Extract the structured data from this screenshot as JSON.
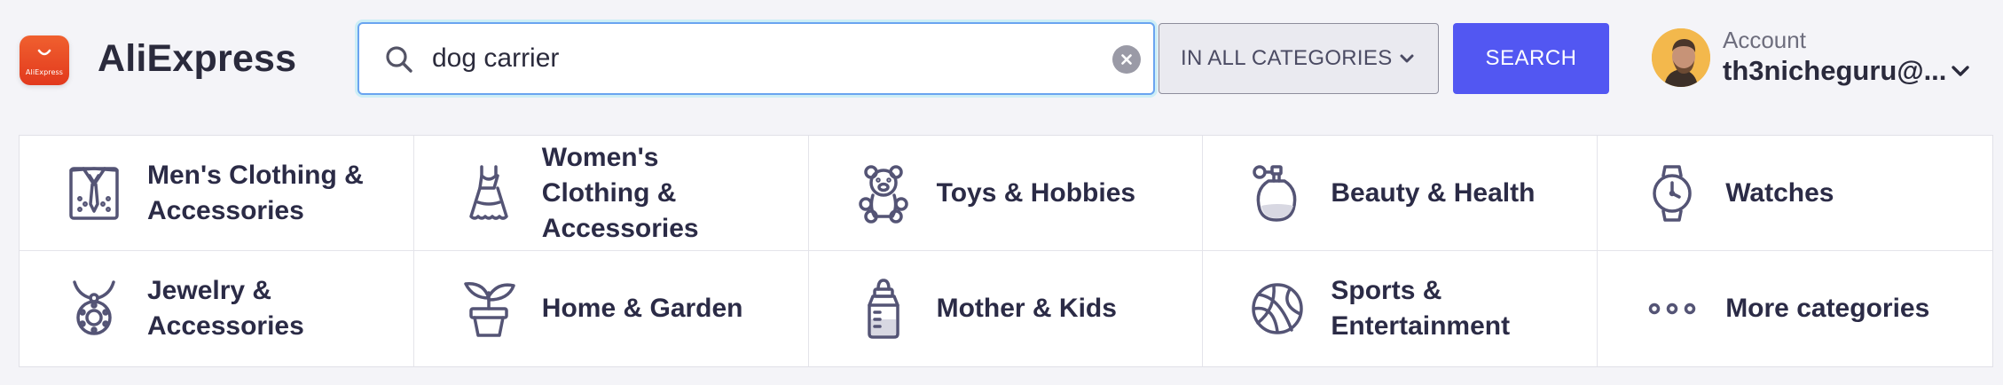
{
  "header": {
    "logo_text": "AliExpress",
    "brand": "AliExpress",
    "search": {
      "value": "dog carrier",
      "placeholder": ""
    },
    "category_select": "IN ALL CATEGORIES",
    "search_button": "SEARCH",
    "account": {
      "label": "Account",
      "email": "th3nicheguru@..."
    }
  },
  "categories": [
    {
      "label": "Men's Clothing & Accessories",
      "icon": "shirt-tie-icon"
    },
    {
      "label": "Women's Clothing & Accessories",
      "icon": "dress-icon"
    },
    {
      "label": "Toys & Hobbies",
      "icon": "teddy-bear-icon"
    },
    {
      "label": "Beauty & Health",
      "icon": "perfume-icon"
    },
    {
      "label": "Watches",
      "icon": "watch-icon"
    },
    {
      "label": "Jewelry & Accessories",
      "icon": "necklace-icon"
    },
    {
      "label": "Home & Garden",
      "icon": "plant-pot-icon"
    },
    {
      "label": "Mother & Kids",
      "icon": "baby-bottle-icon"
    },
    {
      "label": "Sports & Entertainment",
      "icon": "basketball-icon"
    },
    {
      "label": "More categories",
      "icon": "more-dots-icon"
    }
  ],
  "colors": {
    "brand_orange": "#e2391d",
    "search_button": "#5257f2",
    "icon_stroke": "#545475",
    "text": "#2b2b46"
  }
}
